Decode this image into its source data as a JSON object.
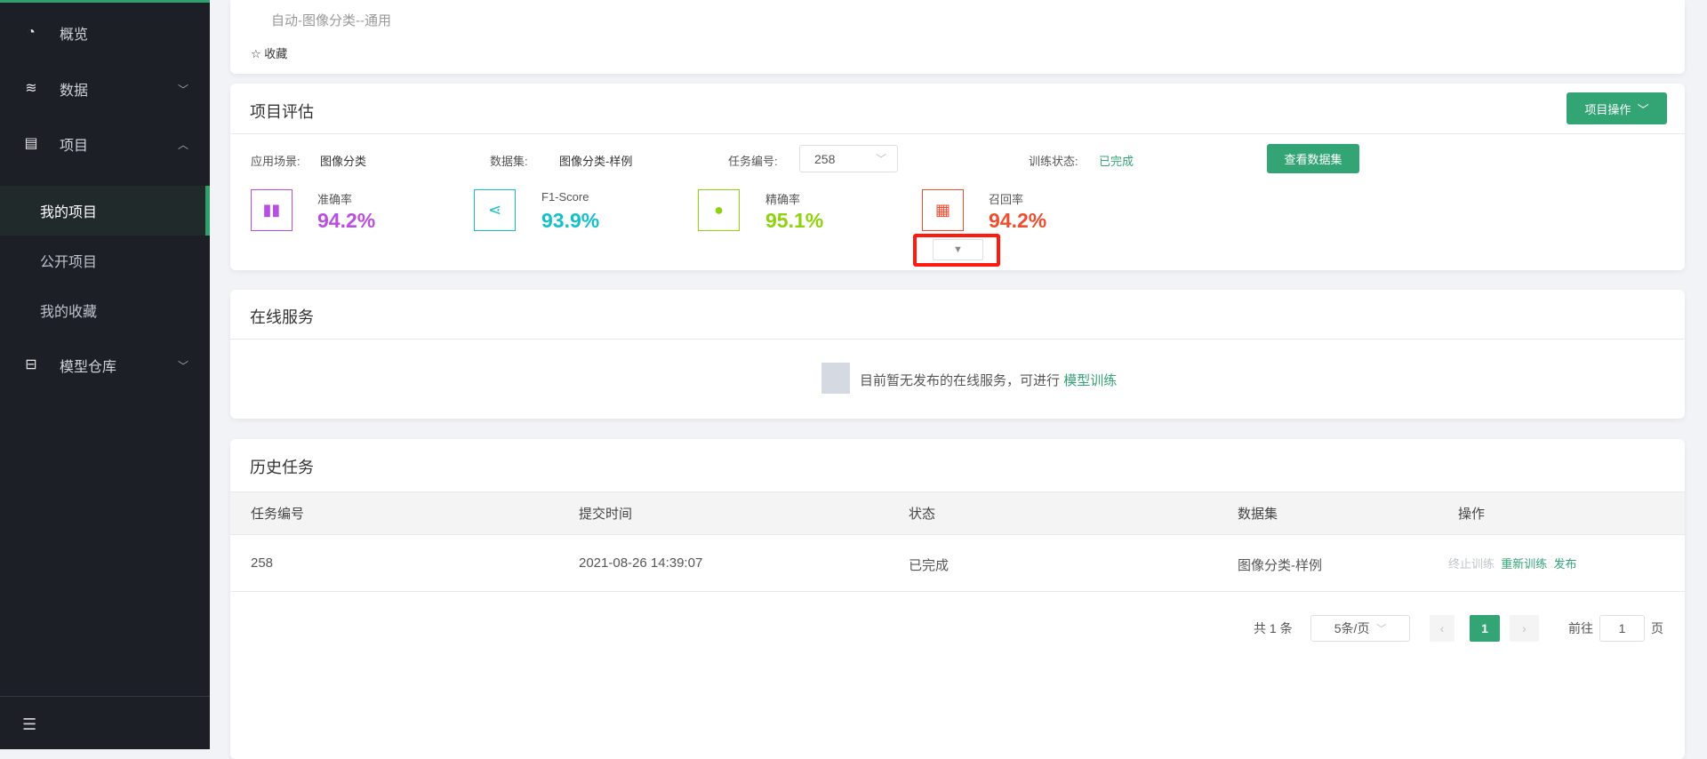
{
  "sidebar": {
    "items": [
      {
        "label": "概览",
        "icon": "dashboard-icon"
      },
      {
        "label": "数据",
        "icon": "database-icon"
      },
      {
        "label": "项目",
        "icon": "project-icon"
      },
      {
        "label": "模型仓库",
        "icon": "model-repo-icon"
      }
    ],
    "sub_items": [
      {
        "label": "我的项目"
      },
      {
        "label": "公开项目"
      },
      {
        "label": "我的收藏"
      }
    ]
  },
  "project": {
    "subtitle": "自动-图像分类--通用",
    "favorite_label": "收藏"
  },
  "evaluation": {
    "title": "项目评估",
    "ops_button": "项目操作",
    "scene_label": "应用场景:",
    "scene_value": "图像分类",
    "dataset_label": "数据集:",
    "dataset_value": "图像分类-样例",
    "task_label": "任务编号:",
    "task_value": "258",
    "status_label": "训练状态:",
    "status_value": "已完成",
    "view_dataset_button": "查看数据集",
    "metrics": [
      {
        "label": "准确率",
        "value": "94.2%",
        "color": "#b94fe0"
      },
      {
        "label": "F1-Score",
        "value": "93.9%",
        "color": "#16c0c8"
      },
      {
        "label": "精确率",
        "value": "95.1%",
        "color": "#8fd20d"
      },
      {
        "label": "召回率",
        "value": "94.2%",
        "color": "#ee4e30"
      }
    ]
  },
  "online_service": {
    "title": "在线服务",
    "empty_text": "目前暂无发布的在线服务，可进行",
    "empty_link": "模型训练"
  },
  "history": {
    "title": "历史任务",
    "columns": [
      "任务编号",
      "提交时间",
      "状态",
      "数据集",
      "操作"
    ],
    "rows": [
      {
        "id": "258",
        "time": "2021-08-26 14:39:07",
        "status": "已完成",
        "dataset": "图像分类-样例",
        "actions": [
          "终止训练",
          "重新训练",
          "发布"
        ]
      }
    ],
    "pagination": {
      "total": "共 1 条",
      "page_size": "5条/页",
      "current": "1",
      "goto_label": "前往",
      "goto_value": "1",
      "page_suffix": "页"
    }
  }
}
